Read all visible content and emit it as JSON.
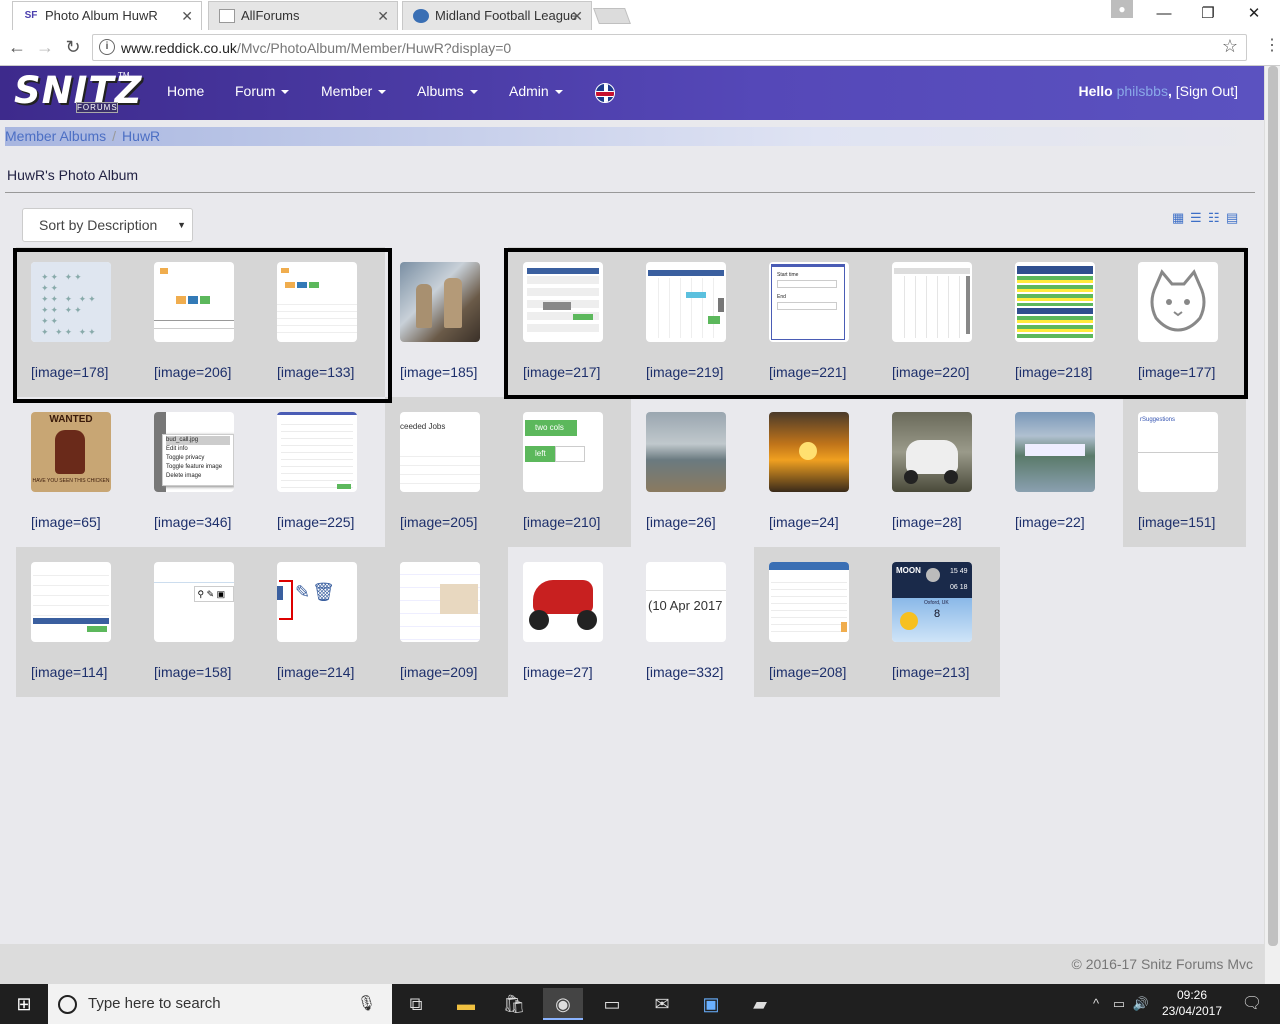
{
  "browser": {
    "tabs": [
      {
        "title": "Photo Album HuwR",
        "favicon": "SF"
      },
      {
        "title": "AllForums",
        "favicon": ""
      },
      {
        "title": "Midland Football League",
        "favicon": ""
      }
    ],
    "url_prefix": "www.reddick.co.uk",
    "url_path": "/Mvc/PhotoAlbum/Member/HuwR?display=0"
  },
  "site": {
    "logo_text": "SNITZ",
    "logo_sub": "FORUMS",
    "logo_tm": "TM",
    "menu": {
      "home": "Home",
      "forum": "Forum",
      "member": "Member",
      "albums": "Albums",
      "admin": "Admin"
    },
    "greeting": "Hello",
    "username": "philsbbs",
    "comma": ",",
    "signout": "[Sign Out]"
  },
  "breadcrumb": {
    "item1": "Member Albums",
    "sep": "/",
    "item2": "HuwR"
  },
  "album": {
    "title": "HuwR's Photo Album",
    "sort_label": "Sort by Description"
  },
  "images": [
    "[image=178]",
    "[image=206]",
    "[image=133]",
    "[image=185]",
    "[image=217]",
    "[image=219]",
    "[image=221]",
    "[image=220]",
    "[image=218]",
    "[image=177]",
    "[image=65]",
    "[image=346]",
    "[image=225]",
    "[image=205]",
    "[image=210]",
    "[image=26]",
    "[image=24]",
    "[image=28]",
    "[image=22]",
    "[image=151]",
    "[image=114]",
    "[image=158]",
    "[image=214]",
    "[image=209]",
    "[image=27]",
    "[image=332]",
    "[image=208]",
    "[image=213]"
  ],
  "thumb_text": {
    "wanted": "WANTED",
    "chicken": "HAVE YOU SEEN THIS CHICKEN",
    "file": "bud_call.jpg",
    "menu1": "Edit info",
    "menu2": "Toggle privacy",
    "menu3": "Toggle feature image",
    "menu4": "Delete image",
    "jobs": "ceeded Jobs",
    "two_cols": "two cols",
    "left": "left",
    "date": "(10 Apr 2017",
    "sugg": "rSuggestions",
    "moon": "MOON",
    "time1": "15 49",
    "time2": "06 18",
    "oxford": "Oxford, UK",
    "temp": "8"
  },
  "footer": "© 2016-17 Snitz Forums Mvc",
  "taskbar": {
    "search_placeholder": "Type here to search",
    "time": "09:26",
    "date": "23/04/2017"
  },
  "colors": {
    "nav": "#4b3fae",
    "link": "#1d2f6b",
    "accent": "#3d6fc7"
  }
}
